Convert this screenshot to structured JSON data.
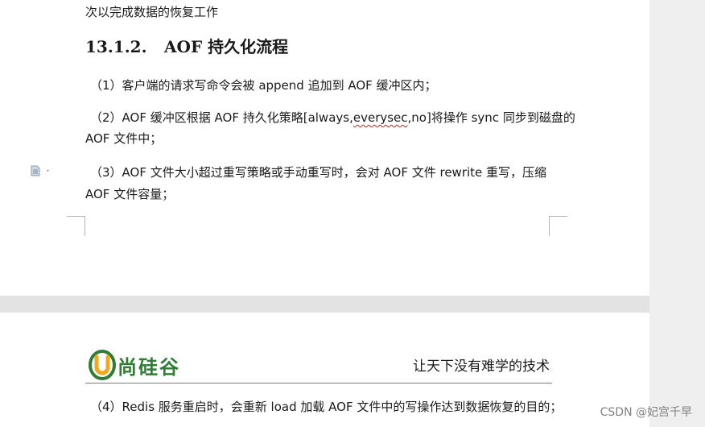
{
  "page1": {
    "intro_line": "次以完成数据的恢复工作",
    "heading": {
      "number": "13.1.2.",
      "title": "AOF 持久化流程"
    },
    "steps": [
      {
        "line1": "（1）客户端的请求写命令会被 append 追加到 AOF 缓冲区内；"
      },
      {
        "line1_before": "（2）AOF 缓冲区根据 AOF 持久化策略[always,",
        "line1_squiggle": "everysec",
        "line1_after": ",no]将操作 sync 同步到磁盘的",
        "line2": "AOF 文件中；"
      },
      {
        "line1": "（3）AOF 文件大小超过重写策略或手动重写时，会对 AOF 文件 rewrite 重写，压缩",
        "line2": "AOF 文件容量；"
      }
    ],
    "margin_icon": "document-icon"
  },
  "page2": {
    "logo": {
      "text": "尚硅谷",
      "color": "#2e7d32",
      "accent": "#f2a81d"
    },
    "slogan": "让天下没有难学的技术",
    "step4": "（4）Redis 服务重启时，会重新 load 加载 AOF 文件中的写操作达到数据恢复的目的；"
  },
  "watermark": "CSDN @妃宫千早"
}
